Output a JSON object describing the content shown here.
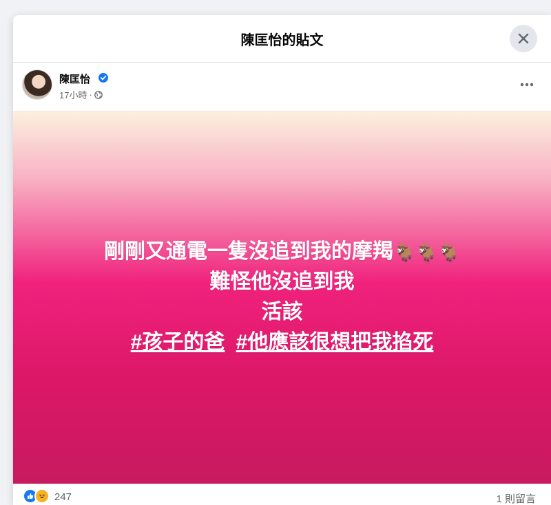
{
  "modal": {
    "title": "陳匡怡的貼文"
  },
  "post": {
    "author": "陳匡怡",
    "time": "17小時",
    "separator": "·",
    "lines": {
      "line1": "剛剛又通電一隻沒追到我的摩羯",
      "goats": "🐐🐐🐐",
      "line2": "難怪他沒追到我",
      "line3": "活該",
      "hashtag1": "#孩子的爸",
      "hashtag2": "#他應該很想把我掐死"
    },
    "background_colors": [
      "#fdf0df",
      "#f0227d",
      "#c81a60"
    ]
  },
  "footer": {
    "reaction_count": "247",
    "comment_count": "1 則留言"
  },
  "icons": {
    "close": "close-icon",
    "verified": "verified-badge-icon",
    "privacy": "globe-icon",
    "more": "more-options-icon",
    "like": "like-reaction-icon",
    "haha": "haha-reaction-icon"
  },
  "colors": {
    "accent": "#1877f2",
    "text_secondary": "#65676b"
  }
}
